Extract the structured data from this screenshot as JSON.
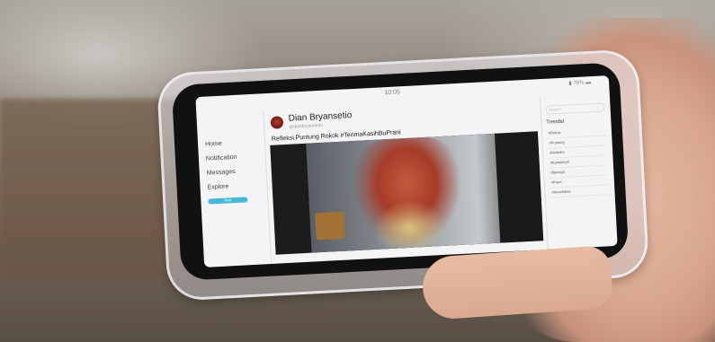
{
  "status_bar": {
    "time": "10:05",
    "icons": "▮ 76% ▬"
  },
  "nav": {
    "items": [
      "Home",
      "Notification",
      "Messages",
      "Explore"
    ],
    "post_button": "Post"
  },
  "post": {
    "user_name": "Dian Bryansetio",
    "user_handle": "@dianbryansetio",
    "text": "Refleksi Puntung Rokok #TerimaKasihBuPrani"
  },
  "sidebar": {
    "search_placeholder": "Search",
    "trends_title": "Trends!",
    "trends": [
      "#Rokok",
      "#Puntung",
      "#Refleksi",
      "#Kampanye",
      "#Bahaya",
      "#Prani",
      "#Kesehatan"
    ]
  },
  "colors": {
    "post_button": "#46b9d8",
    "screen_bg": "#f4f4f6"
  }
}
